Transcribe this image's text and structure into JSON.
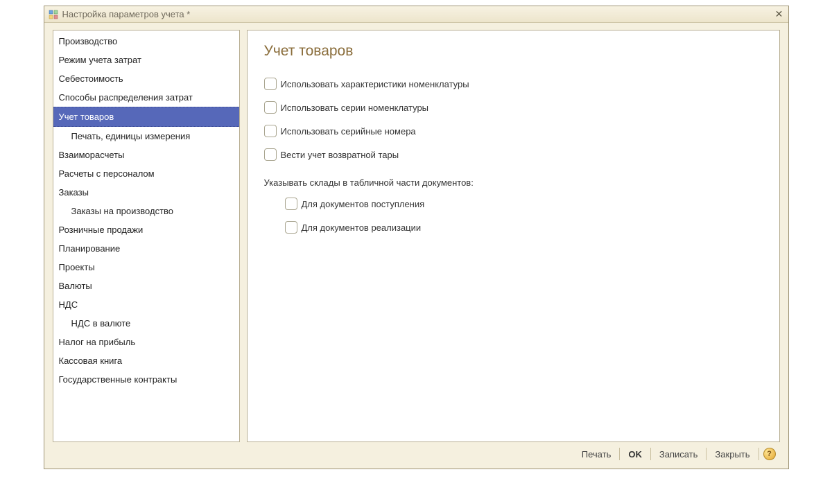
{
  "window": {
    "title": "Настройка параметров учета *"
  },
  "sidebar": {
    "items": [
      {
        "label": "Производство",
        "level": 1
      },
      {
        "label": "Режим учета затрат",
        "level": 1
      },
      {
        "label": "Себестоимость",
        "level": 1
      },
      {
        "label": "Способы распределения затрат",
        "level": 1
      },
      {
        "label": "Учет товаров",
        "level": 1,
        "selected": true
      },
      {
        "label": "Печать, единицы измерения",
        "level": 2
      },
      {
        "label": "Взаиморасчеты",
        "level": 1
      },
      {
        "label": "Расчеты с персоналом",
        "level": 1
      },
      {
        "label": "Заказы",
        "level": 1
      },
      {
        "label": "Заказы на производство",
        "level": 2
      },
      {
        "label": "Розничные продажи",
        "level": 1
      },
      {
        "label": "Планирование",
        "level": 1
      },
      {
        "label": "Проекты",
        "level": 1
      },
      {
        "label": "Валюты",
        "level": 1
      },
      {
        "label": "НДС",
        "level": 1
      },
      {
        "label": "НДС в валюте",
        "level": 2
      },
      {
        "label": "Налог на прибыль",
        "level": 1
      },
      {
        "label": "Кассовая книга",
        "level": 1
      },
      {
        "label": "Государственные контракты",
        "level": 1
      }
    ]
  },
  "main": {
    "title": "Учет товаров",
    "checks": {
      "c1": "Использовать характеристики номенклатуры",
      "c2": "Использовать серии номенклатуры",
      "c3": "Использовать серийные номера",
      "c4": "Вести учет возвратной тары"
    },
    "section_label": "Указывать склады в табличной части документов:",
    "sub_checks": {
      "s1": "Для документов поступления",
      "s2": "Для документов реализации"
    }
  },
  "footer": {
    "print": "Печать",
    "ok": "OK",
    "save": "Записать",
    "close": "Закрыть",
    "help": "?"
  }
}
